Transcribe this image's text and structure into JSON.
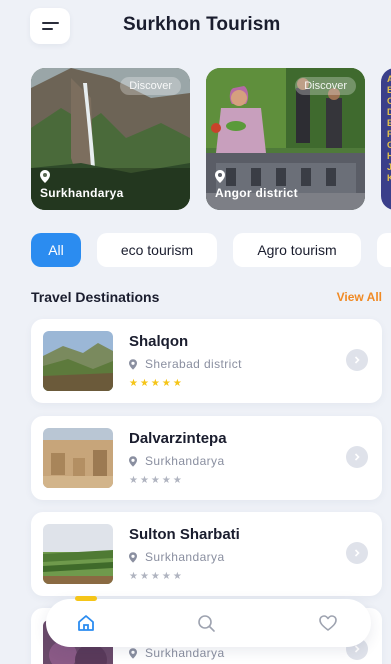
{
  "header": {
    "title": "Surkhon Tourism",
    "menu_icon": "hamburger-icon"
  },
  "featured": [
    {
      "location": "Surkhandarya",
      "badge": "Discover"
    },
    {
      "location": "Angor district",
      "badge": "Discover"
    },
    {
      "location": "",
      "badge": ""
    }
  ],
  "categories": [
    {
      "label": "All",
      "active": true
    },
    {
      "label": "eco tourism",
      "active": false
    },
    {
      "label": "Agro tourism",
      "active": false
    }
  ],
  "section": {
    "title": "Travel Destinations",
    "view_all": "View All"
  },
  "destinations": [
    {
      "name": "Shalqon",
      "location": "Sherabad district",
      "stars": "★★★★★",
      "rating_filled": true
    },
    {
      "name": "Dalvarzintepa",
      "location": "Surkhandarya",
      "stars": "★★★★★",
      "rating_filled": false
    },
    {
      "name": "Sulton Sharbati",
      "location": "Surkhandarya",
      "stars": "★★★★★",
      "rating_filled": false
    },
    {
      "name": "",
      "location": "Surkhandarya",
      "stars": "",
      "rating_filled": false
    }
  ],
  "nav": {
    "items": [
      "home-icon",
      "search-icon",
      "heart-icon"
    ],
    "active": "home-icon"
  },
  "colors": {
    "accent": "#2b8cf0",
    "view_all": "#f08a24",
    "star": "#f5c518",
    "background": "#eef1f7"
  }
}
